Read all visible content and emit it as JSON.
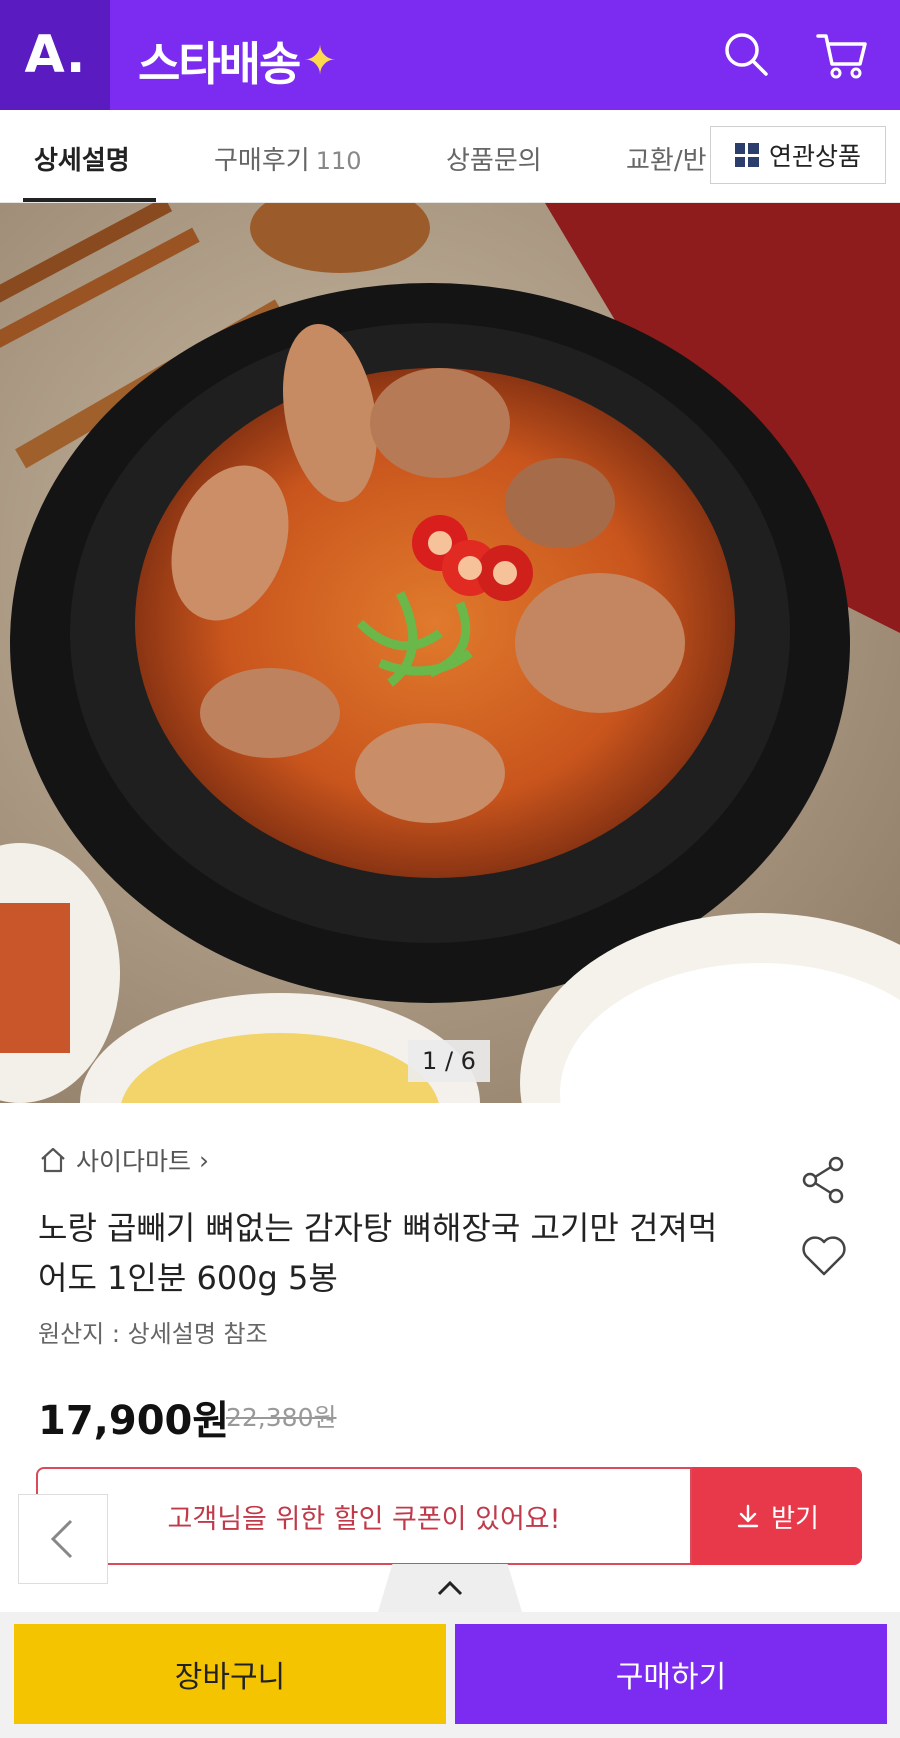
{
  "header": {
    "logo_text": "A.",
    "brand_text": "스타배송",
    "brand_spark": "✦",
    "search_icon": "search-icon",
    "cart_icon": "cart-icon",
    "color": "#7b2cf0"
  },
  "tabs": {
    "items": [
      {
        "label": "상세설명",
        "count": ""
      },
      {
        "label": "구매후기",
        "count": "110"
      },
      {
        "label": "상품문의",
        "count": ""
      },
      {
        "label": "교환/반",
        "count": ""
      }
    ],
    "related_label": "연관상품"
  },
  "gallery": {
    "counter": "1 / 6",
    "image_description": "kimchi bone soup in black clay pot with rice and side dishes"
  },
  "product": {
    "store": "사이다마트",
    "store_chevron": "›",
    "title": "노랑 곱빼기 뼈없는 감자탕 뼈해장국 고기만 건져먹어도 1인분 600g 5봉",
    "origin": "원산지 : 상세설명 참조",
    "price": "17,900원",
    "original_price": "22,380원"
  },
  "coupon": {
    "text": "고객님을 위한 할인 쿠폰이 있어요!",
    "button": "받기",
    "color": "#e8394b"
  },
  "actions": {
    "cart": "장바구니",
    "buy": "구매하기",
    "cart_color": "#f5c400",
    "buy_color": "#7b2cf0"
  }
}
